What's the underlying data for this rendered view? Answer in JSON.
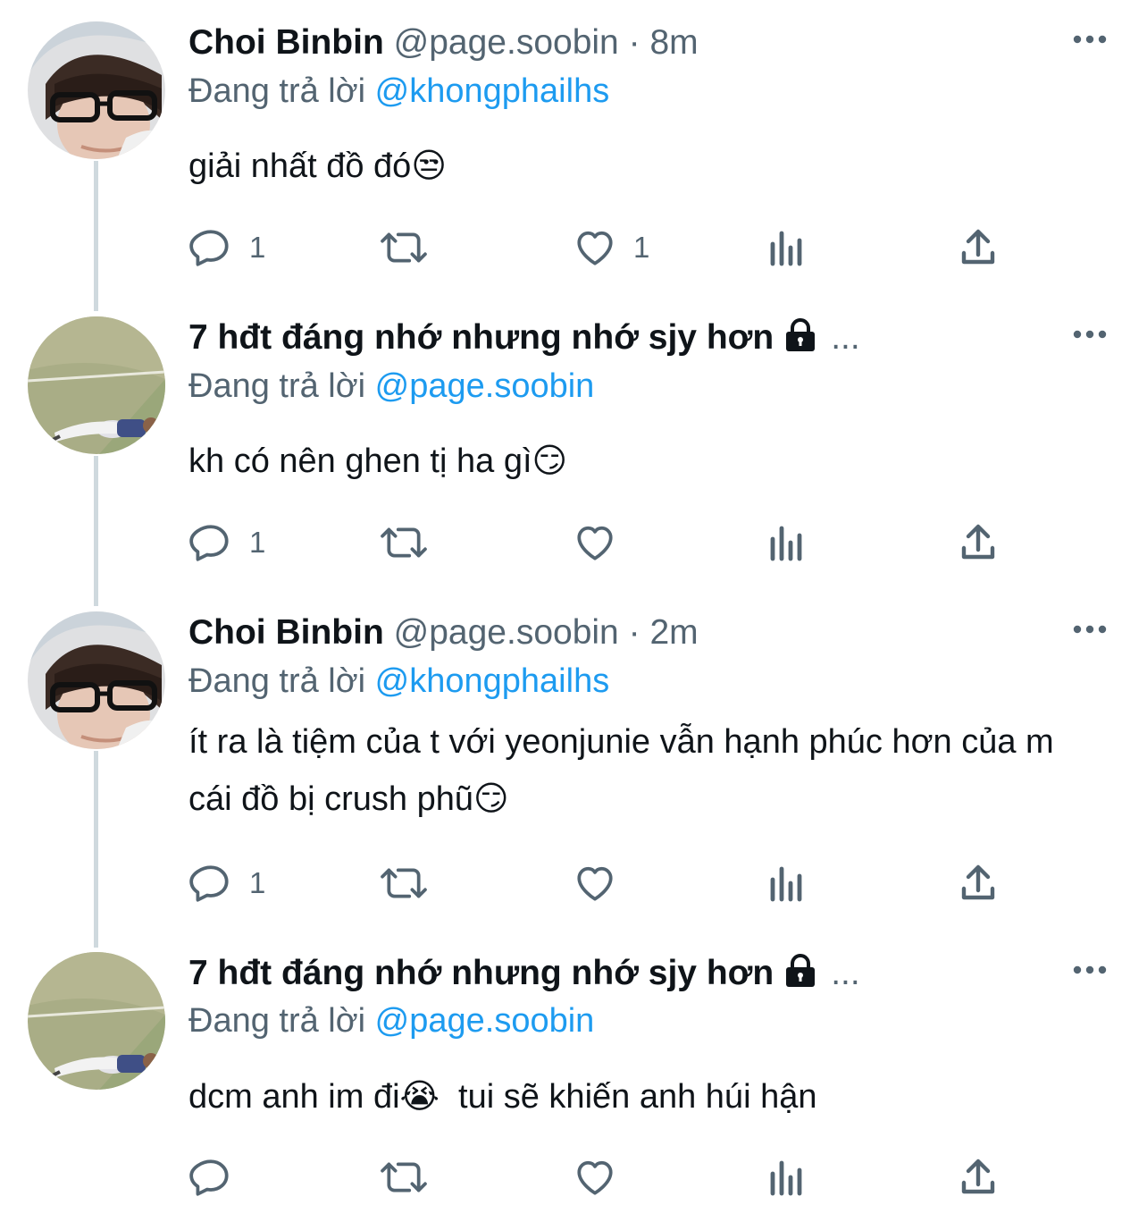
{
  "tweets": [
    {
      "name": "Choi Binbin",
      "handle": "@page.soobin",
      "sep": "·",
      "time": "8m",
      "reply_prefix": "Đang trả lời",
      "reply_to": "@khongphailhs",
      "text": "giải nhất đồ đó😒",
      "reply_count": "1",
      "like_count": "1",
      "avatar": "person-with-glasses",
      "locked": false
    },
    {
      "name": "7 hđt đáng nhớ nhưng nhớ sjy hơn",
      "name_overflow": "...",
      "reply_prefix": "Đang trả lời",
      "reply_to": "@page.soobin",
      "text": "kh có nên ghen tị ha gì😏",
      "reply_count": "1",
      "like_count": "",
      "avatar": "person-lying-on-field",
      "locked": true
    },
    {
      "name": "Choi Binbin",
      "handle": "@page.soobin",
      "sep": "·",
      "time": "2m",
      "reply_prefix": "Đang trả lời",
      "reply_to": "@khongphailhs",
      "text": "ít ra là tiệm của t với yeonjunie vẫn hạnh phúc hơn của m cái đồ bị crush phũ😏",
      "reply_count": "1",
      "like_count": "",
      "avatar": "person-with-glasses",
      "locked": false
    },
    {
      "name": "7 hđt đáng nhớ nhưng nhớ sjy hơn",
      "name_overflow": "...",
      "reply_prefix": "Đang trả lời",
      "reply_to": "@page.soobin",
      "text": "dcm anh im đi😭  tui sẽ khiến anh húi hận",
      "reply_count": "",
      "like_count": "",
      "avatar": "person-lying-on-field",
      "locked": true
    }
  ],
  "colors": {
    "text": "#0f1419",
    "secondary": "#536471",
    "link": "#1d9bf0",
    "thread_line": "#cfd9de"
  }
}
